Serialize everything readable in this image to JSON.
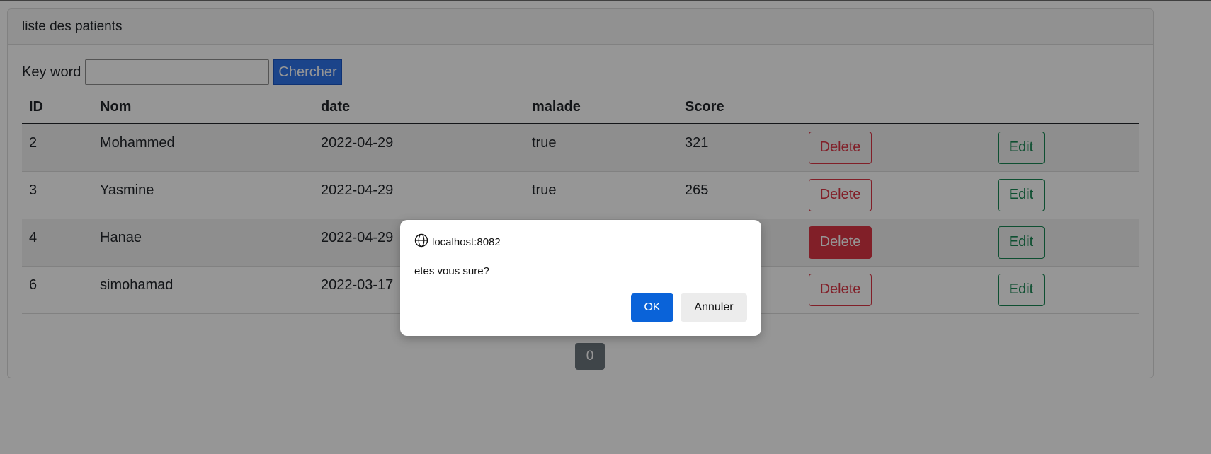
{
  "card": {
    "title": "liste des patients"
  },
  "search": {
    "label": "Key word",
    "value": "",
    "button_label": "Chercher"
  },
  "table": {
    "headers": [
      "ID",
      "Nom",
      "date",
      "malade",
      "Score"
    ],
    "rows": [
      {
        "id": "2",
        "nom": "Mohammed",
        "date": "2022-04-29",
        "malade": "true",
        "score": "321",
        "delete_label": "Delete",
        "edit_label": "Edit"
      },
      {
        "id": "3",
        "nom": "Yasmine",
        "date": "2022-04-29",
        "malade": "true",
        "score": "265",
        "delete_label": "Delete",
        "edit_label": "Edit"
      },
      {
        "id": "4",
        "nom": "Hanae",
        "date": "2022-04-29",
        "malade": "",
        "score": "",
        "delete_label": "Delete",
        "edit_label": "Edit"
      },
      {
        "id": "6",
        "nom": "simohamad",
        "date": "2022-03-17",
        "malade": "",
        "score": "",
        "delete_label": "Delete",
        "edit_label": "Edit"
      }
    ]
  },
  "pagination": {
    "current_page": "0"
  },
  "dialog": {
    "origin": "localhost:8082",
    "origin_icon": "globe-icon",
    "message": "etes vous sure?",
    "ok_label": "OK",
    "cancel_label": "Annuler"
  },
  "colors": {
    "primary": "#2f74ea",
    "danger": "#dc3545",
    "success": "#198754",
    "dialog_ok": "#0a63d9"
  }
}
